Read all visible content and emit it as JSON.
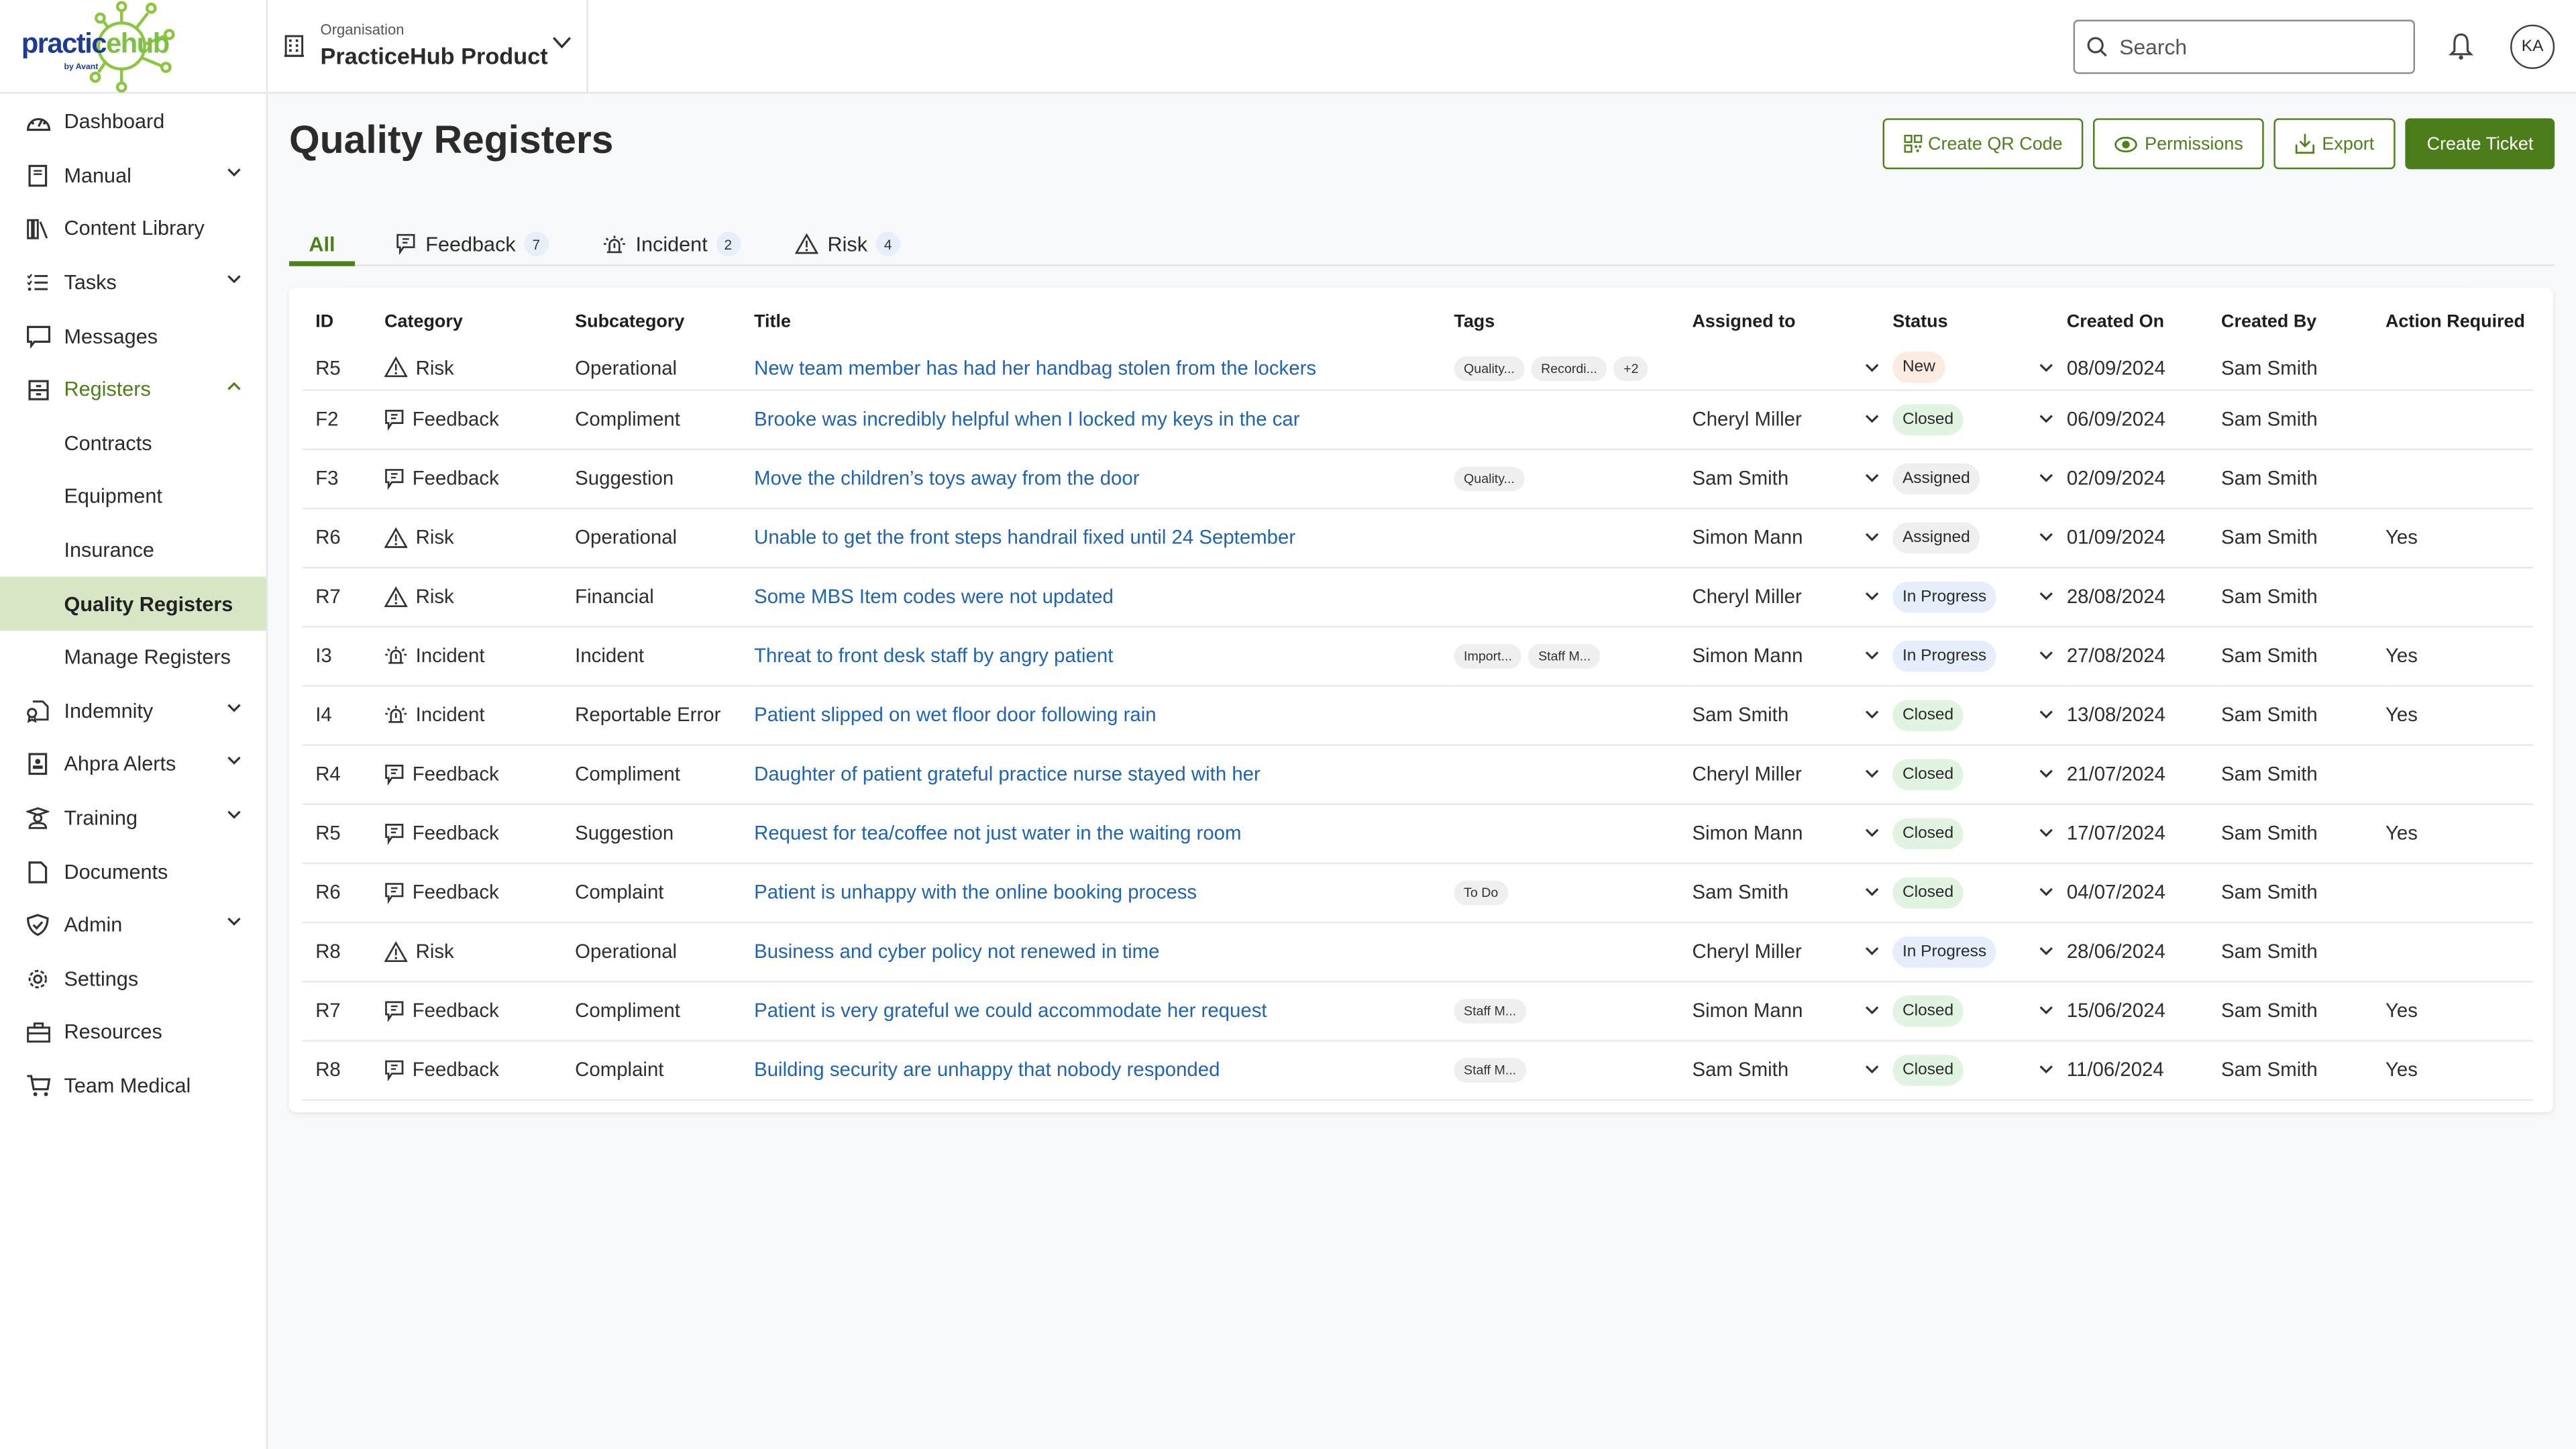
{
  "brand": {
    "logo_word_a": "practic",
    "logo_word_b": "ehub",
    "logo_by": "by Avant"
  },
  "sidebar": {
    "items": [
      {
        "label": "Dashboard",
        "icon": "dashboard-gauge-icon",
        "chevron": ""
      },
      {
        "label": "Manual",
        "icon": "book-icon",
        "chevron": "down"
      },
      {
        "label": "Content Library",
        "icon": "library-icon",
        "chevron": ""
      },
      {
        "label": "Tasks",
        "icon": "checklist-icon",
        "chevron": "down"
      },
      {
        "label": "Messages",
        "icon": "chat-icon",
        "chevron": ""
      },
      {
        "label": "Registers",
        "icon": "cabinet-icon",
        "chevron": "up",
        "open": true
      },
      {
        "label": "Contracts",
        "sub": true
      },
      {
        "label": "Equipment",
        "sub": true
      },
      {
        "label": "Insurance",
        "sub": true
      },
      {
        "label": "Quality Registers",
        "sub": true,
        "active": true
      },
      {
        "label": "Manage Registers",
        "sub": true
      },
      {
        "label": "Indemnity",
        "icon": "certificate-icon",
        "chevron": "down"
      },
      {
        "label": "Ahpra Alerts",
        "icon": "id-badge-icon",
        "chevron": "down"
      },
      {
        "label": "Training",
        "icon": "graduate-icon",
        "chevron": "down"
      },
      {
        "label": "Documents",
        "icon": "document-icon",
        "chevron": ""
      },
      {
        "label": "Admin",
        "icon": "shield-check-icon",
        "chevron": "down"
      },
      {
        "label": "Settings",
        "icon": "gear-icon",
        "chevron": ""
      },
      {
        "label": "Resources",
        "icon": "briefcase-icon",
        "chevron": ""
      },
      {
        "label": "Team Medical",
        "icon": "cart-icon",
        "chevron": ""
      }
    ]
  },
  "topbar": {
    "org_label": "Organisation",
    "org_value": "PracticeHub Product",
    "search_placeholder": "Search",
    "avatar_initials": "KA"
  },
  "page": {
    "title": "Quality Registers",
    "actions": {
      "qr": "Create QR Code",
      "permissions": "Permissions",
      "export": "Export",
      "create": "Create Ticket"
    },
    "tabs": [
      {
        "label": "All",
        "active": true
      },
      {
        "label": "Feedback",
        "count": "7"
      },
      {
        "label": "Incident",
        "count": "2"
      },
      {
        "label": "Risk",
        "count": "4"
      }
    ]
  },
  "table": {
    "columns": [
      "ID",
      "Category",
      "Subcategory",
      "Title",
      "Tags",
      "Assigned to",
      "Status",
      "Created On",
      "Created By",
      "Action Required"
    ],
    "rows": [
      {
        "id": "R5",
        "category": "Risk",
        "subcategory": "Operational",
        "title": "New team member has had her handbag stolen from the lockers",
        "tags": [
          "Quality...",
          "Recordi...",
          "+2"
        ],
        "assigned": "",
        "status": "New",
        "created_on": "08/09/2024",
        "created_by": "Sam Smith",
        "action": ""
      },
      {
        "id": "F2",
        "category": "Feedback",
        "subcategory": "Compliment",
        "title": "Brooke was incredibly helpful when I locked my keys in the car",
        "tags": [],
        "assigned": "Cheryl Miller",
        "status": "Closed",
        "created_on": "06/09/2024",
        "created_by": "Sam Smith",
        "action": ""
      },
      {
        "id": "F3",
        "category": "Feedback",
        "subcategory": "Suggestion",
        "title": "Move the children’s toys away from the door",
        "tags": [
          "Quality..."
        ],
        "assigned": "Sam Smith",
        "status": "Assigned",
        "created_on": "02/09/2024",
        "created_by": "Sam Smith",
        "action": ""
      },
      {
        "id": "R6",
        "category": "Risk",
        "subcategory": "Operational",
        "title": "Unable to get the front steps handrail fixed until  24 September",
        "tags": [],
        "assigned": "Simon Mann",
        "status": "Assigned",
        "created_on": "01/09/2024",
        "created_by": "Sam Smith",
        "action": "Yes"
      },
      {
        "id": "R7",
        "category": "Risk",
        "subcategory": "Financial",
        "title": "Some MBS Item codes were not updated",
        "tags": [],
        "assigned": "Cheryl Miller",
        "status": "In Progress",
        "created_on": "28/08/2024",
        "created_by": "Sam Smith",
        "action": ""
      },
      {
        "id": "I3",
        "category": "Incident",
        "subcategory": "Incident",
        "title": "Threat to front desk staff by angry patient",
        "tags": [
          "Import...",
          "Staff M..."
        ],
        "assigned": "Simon Mann",
        "status": "In Progress",
        "created_on": "27/08/2024",
        "created_by": "Sam Smith",
        "action": "Yes"
      },
      {
        "id": "I4",
        "category": "Incident",
        "subcategory": "Reportable Error",
        "title": "Patient slipped on wet floor door following rain",
        "tags": [],
        "assigned": "Sam Smith",
        "status": "Closed",
        "created_on": "13/08/2024",
        "created_by": "Sam Smith",
        "action": "Yes"
      },
      {
        "id": "R4",
        "category": "Feedback",
        "subcategory": "Compliment",
        "title": "Daughter of patient grateful practice nurse stayed with her",
        "tags": [],
        "assigned": "Cheryl Miller",
        "status": "Closed",
        "created_on": "21/07/2024",
        "created_by": "Sam Smith",
        "action": ""
      },
      {
        "id": "R5",
        "category": "Feedback",
        "subcategory": "Suggestion",
        "title": "Request for tea/coffee not just water in the waiting room",
        "tags": [],
        "assigned": "Simon Mann",
        "status": "Closed",
        "created_on": "17/07/2024",
        "created_by": "Sam Smith",
        "action": "Yes"
      },
      {
        "id": "R6",
        "category": "Feedback",
        "subcategory": "Complaint",
        "title": "Patient is unhappy with the online booking process",
        "tags": [
          "To Do"
        ],
        "assigned": "Sam Smith",
        "status": "Closed",
        "created_on": "04/07/2024",
        "created_by": "Sam Smith",
        "action": ""
      },
      {
        "id": "R8",
        "category": "Risk",
        "subcategory": "Operational",
        "title": "Business and cyber policy not renewed in time",
        "tags": [],
        "assigned": "Cheryl Miller",
        "status": "In Progress",
        "created_on": "28/06/2024",
        "created_by": "Sam Smith",
        "action": ""
      },
      {
        "id": "R7",
        "category": "Feedback",
        "subcategory": "Compliment",
        "title": "Patient is very grateful we could accommodate her request",
        "tags": [
          "Staff M..."
        ],
        "assigned": "Simon Mann",
        "status": "Closed",
        "created_on": "15/06/2024",
        "created_by": "Sam Smith",
        "action": "Yes"
      },
      {
        "id": "R8",
        "category": "Feedback",
        "subcategory": "Complaint",
        "title": "Building security are unhappy that nobody responded",
        "tags": [
          "Staff M..."
        ],
        "assigned": "Sam Smith",
        "status": "Closed",
        "created_on": "11/06/2024",
        "created_by": "Sam Smith",
        "action": "Yes"
      }
    ]
  },
  "colors": {
    "brand_green": "#4d7f1a",
    "link_blue": "#1f63b5",
    "active_nav_bg": "#d8e6c6",
    "status_new": "#fbebe0",
    "status_closed": "#e1f3e1",
    "status_assigned": "#efefef",
    "status_in_progress": "#e6edfb"
  }
}
